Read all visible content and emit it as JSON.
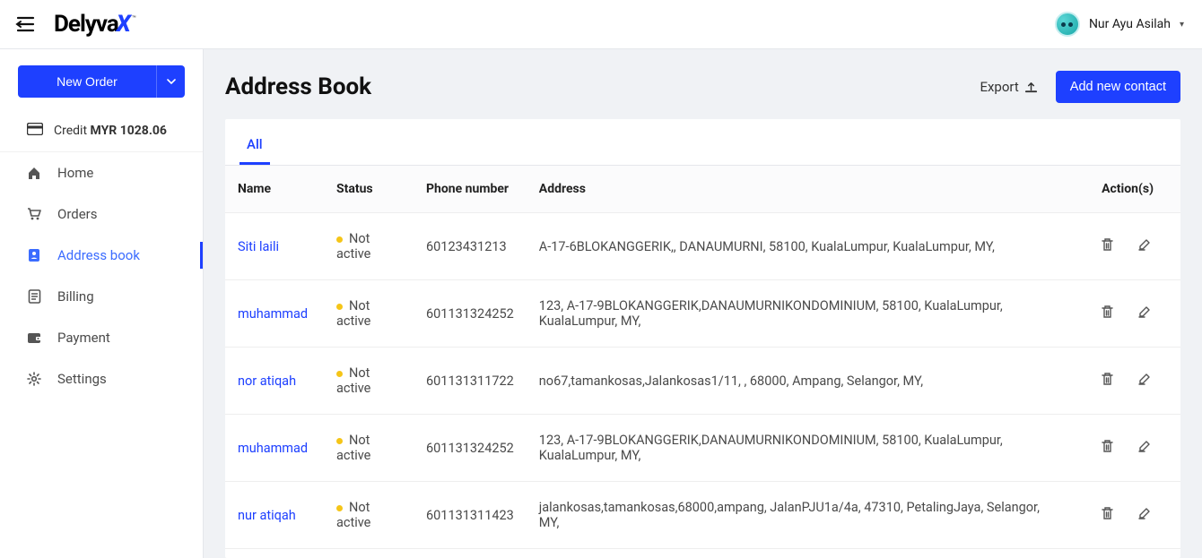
{
  "header": {
    "brand": "Delyva",
    "user_name": "Nur Ayu Asilah"
  },
  "sidebar": {
    "new_order_label": "New Order",
    "credit_prefix": "Credit",
    "credit_value": "MYR 1028.06",
    "items": [
      {
        "icon": "home",
        "label": "Home"
      },
      {
        "icon": "cart",
        "label": "Orders"
      },
      {
        "icon": "contact",
        "label": "Address book"
      },
      {
        "icon": "receipt",
        "label": "Billing"
      },
      {
        "icon": "wallet",
        "label": "Payment"
      },
      {
        "icon": "gear",
        "label": "Settings"
      }
    ]
  },
  "page": {
    "title": "Address Book",
    "export_label": "Export",
    "add_label": "Add new contact",
    "tabs": [
      {
        "label": "All"
      }
    ]
  },
  "table": {
    "headers": {
      "name": "Name",
      "status": "Status",
      "phone": "Phone number",
      "address": "Address",
      "actions": "Action(s)"
    },
    "rows": [
      {
        "name": "Siti laili",
        "status": "Not active",
        "phone": "60123431213",
        "address": "A-17-6BLOKANGGERIK,, DANAUMURNI, 58100, KualaLumpur, KualaLumpur, MY,"
      },
      {
        "name": "muhammad",
        "status": "Not active",
        "phone": "601131324252",
        "address": "123, A-17-9BLOKANGGERIK,DANAUMURNIKONDOMINIUM, 58100, KualaLumpur, KualaLumpur, MY,"
      },
      {
        "name": "nor atiqah",
        "status": "Not active",
        "phone": "601131311722",
        "address": "no67,tamankosas,Jalankosas1/11, , 68000, Ampang, Selangor, MY,"
      },
      {
        "name": "muhammad",
        "status": "Not active",
        "phone": "601131324252",
        "address": "123, A-17-9BLOKANGGERIK,DANAUMURNIKONDOMINIUM, 58100, KualaLumpur, KualaLumpur, MY,"
      },
      {
        "name": "nur atiqah",
        "status": "Not active",
        "phone": "601131311423",
        "address": "jalankosas,tamankosas,68000,ampang, JalanPJU1a/4a, 47310, PetalingJaya, Selangor, MY,"
      }
    ]
  }
}
